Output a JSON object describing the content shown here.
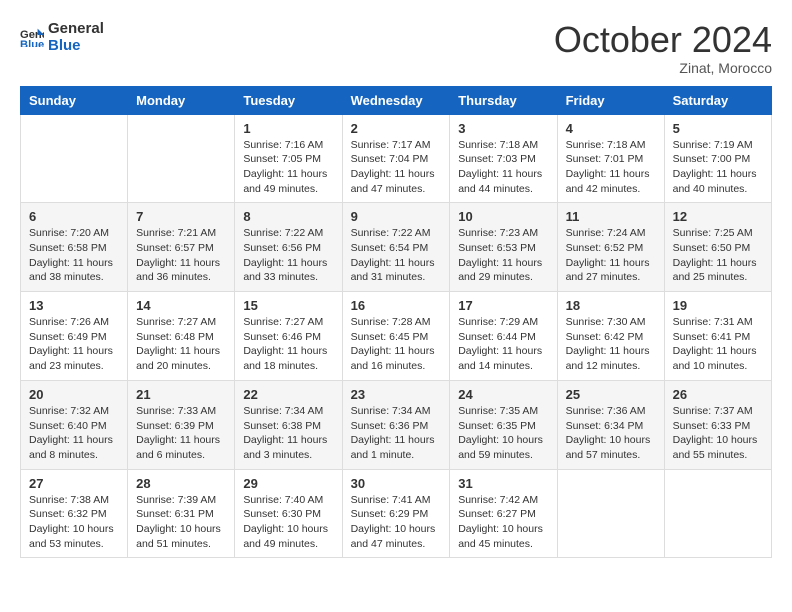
{
  "header": {
    "logo_line1": "General",
    "logo_line2": "Blue",
    "month": "October 2024",
    "location": "Zinat, Morocco"
  },
  "weekdays": [
    "Sunday",
    "Monday",
    "Tuesday",
    "Wednesday",
    "Thursday",
    "Friday",
    "Saturday"
  ],
  "weeks": [
    [
      {
        "day": "",
        "sunrise": "",
        "sunset": "",
        "daylight": ""
      },
      {
        "day": "",
        "sunrise": "",
        "sunset": "",
        "daylight": ""
      },
      {
        "day": "1",
        "sunrise": "Sunrise: 7:16 AM",
        "sunset": "Sunset: 7:05 PM",
        "daylight": "Daylight: 11 hours and 49 minutes."
      },
      {
        "day": "2",
        "sunrise": "Sunrise: 7:17 AM",
        "sunset": "Sunset: 7:04 PM",
        "daylight": "Daylight: 11 hours and 47 minutes."
      },
      {
        "day": "3",
        "sunrise": "Sunrise: 7:18 AM",
        "sunset": "Sunset: 7:03 PM",
        "daylight": "Daylight: 11 hours and 44 minutes."
      },
      {
        "day": "4",
        "sunrise": "Sunrise: 7:18 AM",
        "sunset": "Sunset: 7:01 PM",
        "daylight": "Daylight: 11 hours and 42 minutes."
      },
      {
        "day": "5",
        "sunrise": "Sunrise: 7:19 AM",
        "sunset": "Sunset: 7:00 PM",
        "daylight": "Daylight: 11 hours and 40 minutes."
      }
    ],
    [
      {
        "day": "6",
        "sunrise": "Sunrise: 7:20 AM",
        "sunset": "Sunset: 6:58 PM",
        "daylight": "Daylight: 11 hours and 38 minutes."
      },
      {
        "day": "7",
        "sunrise": "Sunrise: 7:21 AM",
        "sunset": "Sunset: 6:57 PM",
        "daylight": "Daylight: 11 hours and 36 minutes."
      },
      {
        "day": "8",
        "sunrise": "Sunrise: 7:22 AM",
        "sunset": "Sunset: 6:56 PM",
        "daylight": "Daylight: 11 hours and 33 minutes."
      },
      {
        "day": "9",
        "sunrise": "Sunrise: 7:22 AM",
        "sunset": "Sunset: 6:54 PM",
        "daylight": "Daylight: 11 hours and 31 minutes."
      },
      {
        "day": "10",
        "sunrise": "Sunrise: 7:23 AM",
        "sunset": "Sunset: 6:53 PM",
        "daylight": "Daylight: 11 hours and 29 minutes."
      },
      {
        "day": "11",
        "sunrise": "Sunrise: 7:24 AM",
        "sunset": "Sunset: 6:52 PM",
        "daylight": "Daylight: 11 hours and 27 minutes."
      },
      {
        "day": "12",
        "sunrise": "Sunrise: 7:25 AM",
        "sunset": "Sunset: 6:50 PM",
        "daylight": "Daylight: 11 hours and 25 minutes."
      }
    ],
    [
      {
        "day": "13",
        "sunrise": "Sunrise: 7:26 AM",
        "sunset": "Sunset: 6:49 PM",
        "daylight": "Daylight: 11 hours and 23 minutes."
      },
      {
        "day": "14",
        "sunrise": "Sunrise: 7:27 AM",
        "sunset": "Sunset: 6:48 PM",
        "daylight": "Daylight: 11 hours and 20 minutes."
      },
      {
        "day": "15",
        "sunrise": "Sunrise: 7:27 AM",
        "sunset": "Sunset: 6:46 PM",
        "daylight": "Daylight: 11 hours and 18 minutes."
      },
      {
        "day": "16",
        "sunrise": "Sunrise: 7:28 AM",
        "sunset": "Sunset: 6:45 PM",
        "daylight": "Daylight: 11 hours and 16 minutes."
      },
      {
        "day": "17",
        "sunrise": "Sunrise: 7:29 AM",
        "sunset": "Sunset: 6:44 PM",
        "daylight": "Daylight: 11 hours and 14 minutes."
      },
      {
        "day": "18",
        "sunrise": "Sunrise: 7:30 AM",
        "sunset": "Sunset: 6:42 PM",
        "daylight": "Daylight: 11 hours and 12 minutes."
      },
      {
        "day": "19",
        "sunrise": "Sunrise: 7:31 AM",
        "sunset": "Sunset: 6:41 PM",
        "daylight": "Daylight: 11 hours and 10 minutes."
      }
    ],
    [
      {
        "day": "20",
        "sunrise": "Sunrise: 7:32 AM",
        "sunset": "Sunset: 6:40 PM",
        "daylight": "Daylight: 11 hours and 8 minutes."
      },
      {
        "day": "21",
        "sunrise": "Sunrise: 7:33 AM",
        "sunset": "Sunset: 6:39 PM",
        "daylight": "Daylight: 11 hours and 6 minutes."
      },
      {
        "day": "22",
        "sunrise": "Sunrise: 7:34 AM",
        "sunset": "Sunset: 6:38 PM",
        "daylight": "Daylight: 11 hours and 3 minutes."
      },
      {
        "day": "23",
        "sunrise": "Sunrise: 7:34 AM",
        "sunset": "Sunset: 6:36 PM",
        "daylight": "Daylight: 11 hours and 1 minute."
      },
      {
        "day": "24",
        "sunrise": "Sunrise: 7:35 AM",
        "sunset": "Sunset: 6:35 PM",
        "daylight": "Daylight: 10 hours and 59 minutes."
      },
      {
        "day": "25",
        "sunrise": "Sunrise: 7:36 AM",
        "sunset": "Sunset: 6:34 PM",
        "daylight": "Daylight: 10 hours and 57 minutes."
      },
      {
        "day": "26",
        "sunrise": "Sunrise: 7:37 AM",
        "sunset": "Sunset: 6:33 PM",
        "daylight": "Daylight: 10 hours and 55 minutes."
      }
    ],
    [
      {
        "day": "27",
        "sunrise": "Sunrise: 7:38 AM",
        "sunset": "Sunset: 6:32 PM",
        "daylight": "Daylight: 10 hours and 53 minutes."
      },
      {
        "day": "28",
        "sunrise": "Sunrise: 7:39 AM",
        "sunset": "Sunset: 6:31 PM",
        "daylight": "Daylight: 10 hours and 51 minutes."
      },
      {
        "day": "29",
        "sunrise": "Sunrise: 7:40 AM",
        "sunset": "Sunset: 6:30 PM",
        "daylight": "Daylight: 10 hours and 49 minutes."
      },
      {
        "day": "30",
        "sunrise": "Sunrise: 7:41 AM",
        "sunset": "Sunset: 6:29 PM",
        "daylight": "Daylight: 10 hours and 47 minutes."
      },
      {
        "day": "31",
        "sunrise": "Sunrise: 7:42 AM",
        "sunset": "Sunset: 6:27 PM",
        "daylight": "Daylight: 10 hours and 45 minutes."
      },
      {
        "day": "",
        "sunrise": "",
        "sunset": "",
        "daylight": ""
      },
      {
        "day": "",
        "sunrise": "",
        "sunset": "",
        "daylight": ""
      }
    ]
  ]
}
